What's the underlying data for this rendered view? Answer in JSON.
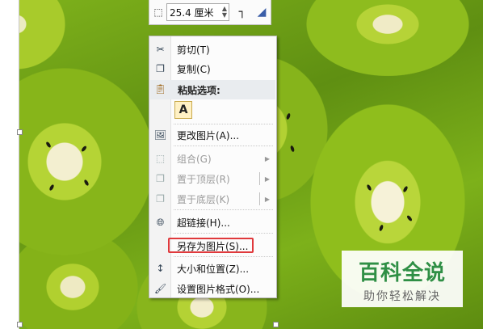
{
  "toolbar": {
    "crop_icon": "crop-corner-icon",
    "size_value": "25.4 厘米",
    "spin_icon": "spin-up-down-icon",
    "crop_tool_icon": "crop-tool-icon",
    "shape_fill_icon": "shape-fill-icon"
  },
  "menu": {
    "cut": "剪切(T)",
    "copy": "复制(C)",
    "paste_options": "粘贴选项:",
    "paste_keep_text": "A",
    "change_picture": "更改图片(A)...",
    "group": "组合(G)",
    "bring_front": "置于顶层(R)",
    "send_back": "置于底层(K)",
    "hyperlink": "超链接(H)...",
    "save_as_picture": "另存为图片(S)...",
    "size_position": "大小和位置(Z)...",
    "format_picture": "设置图片格式(O)..."
  },
  "watermark": {
    "title": "百科全说",
    "subtitle": "助你轻松解决"
  },
  "colors": {
    "highlight": "#e0393c",
    "watermark_green": "#2f8f45"
  }
}
